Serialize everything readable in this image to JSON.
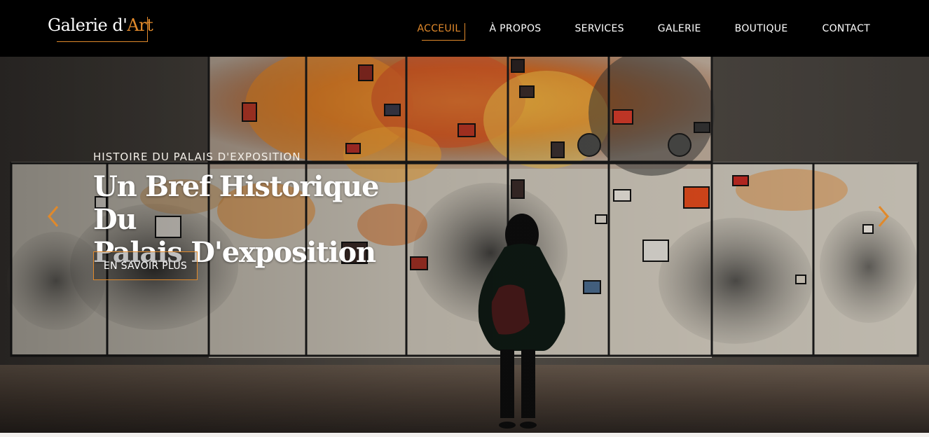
{
  "brand": {
    "logo_main": "Galerie d'",
    "logo_accent": "Art",
    "accent_color": "#e0892b"
  },
  "nav": {
    "items": [
      {
        "label": "ACCEUIL",
        "active": true
      },
      {
        "label": "À PROPOS",
        "active": false
      },
      {
        "label": "SERVICES",
        "active": false
      },
      {
        "label": "GALERIE",
        "active": false
      },
      {
        "label": "BOUTIQUE",
        "active": false
      },
      {
        "label": "CONTACT",
        "active": false
      }
    ]
  },
  "hero": {
    "eyebrow": "HISTOIRE DU PALAIS D'EXPOSITION",
    "title_line1": "Un Bref Historique Du",
    "title_line2": "Palais D'exposition",
    "cta_label": "EN SAVOIR PLUS",
    "prev_icon": "chevron-left-icon",
    "next_icon": "chevron-right-icon"
  }
}
